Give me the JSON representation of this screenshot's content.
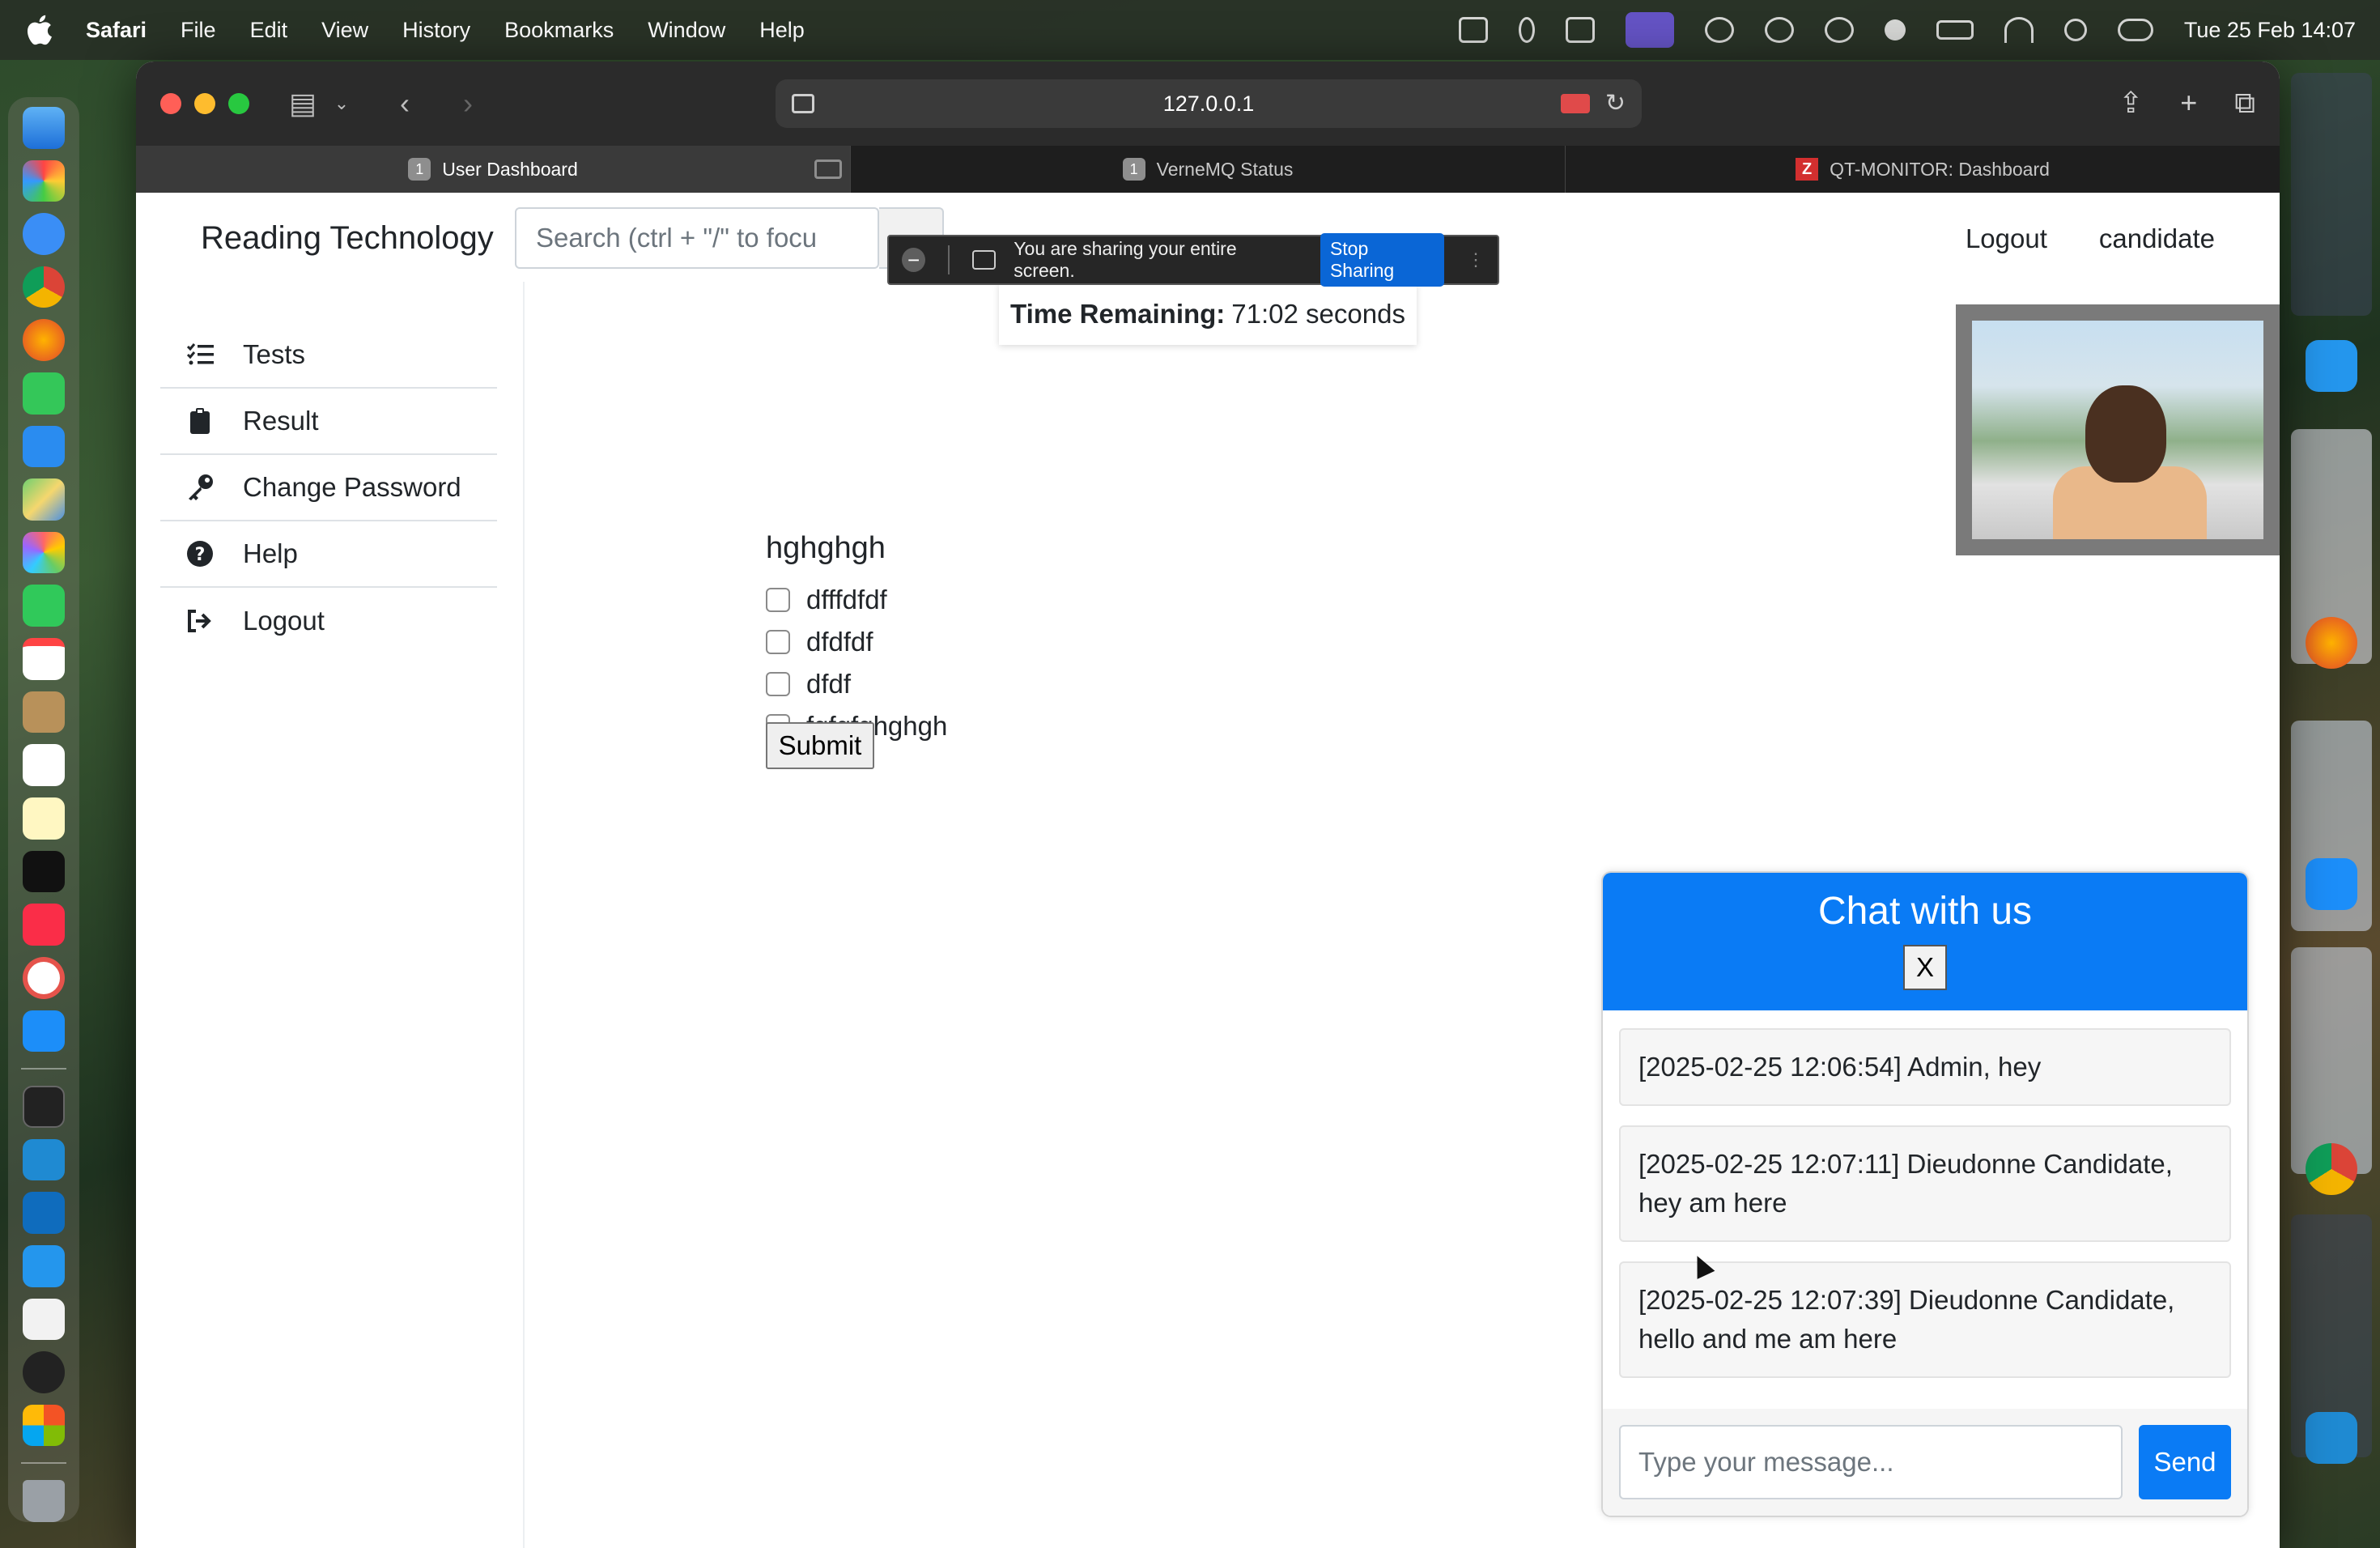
{
  "menubar": {
    "app": "Safari",
    "items": [
      "File",
      "Edit",
      "View",
      "History",
      "Bookmarks",
      "Window",
      "Help"
    ],
    "clock": "Tue 25 Feb  14:07"
  },
  "browser": {
    "address": "127.0.0.1",
    "tabs": [
      {
        "badge": "1",
        "label": "User Dashboard",
        "active": true
      },
      {
        "badge": "1",
        "label": "VerneMQ Status",
        "active": false
      },
      {
        "badge": "Z",
        "label": "QT-MONITOR: Dashboard",
        "active": false
      }
    ]
  },
  "header": {
    "brand": "Reading Technology",
    "search_placeholder": "Search (ctrl + \"/\" to focu",
    "logout": "Logout",
    "user": "candidate"
  },
  "share_banner": {
    "text": "You are sharing your entire screen.",
    "stop_label": "Stop Sharing"
  },
  "timer": {
    "label": "Time Remaining:",
    "value": "71:02 seconds"
  },
  "sidebar": {
    "items": [
      {
        "label": "Tests",
        "icon": "tasks-icon"
      },
      {
        "label": "Result",
        "icon": "clipboard-icon"
      },
      {
        "label": "Change Password",
        "icon": "key-icon"
      },
      {
        "label": "Help",
        "icon": "question-circle-icon"
      },
      {
        "label": "Logout",
        "icon": "sign-out-icon"
      }
    ]
  },
  "question": {
    "title": "hghghgh",
    "options": [
      "dfffdfdf",
      "dfdfdf",
      "dfdf",
      "fgfgfghghgh"
    ],
    "submit_label": "Submit"
  },
  "chat": {
    "title": "Chat with us",
    "close_label": "X",
    "messages": [
      "[2025-02-25 12:06:54] Admin, hey",
      "[2025-02-25 12:07:11] Dieudonne Candidate, hey am here",
      "[2025-02-25 12:07:39] Dieudonne Candidate, hello and me am here"
    ],
    "input_placeholder": "Type your message...",
    "send_label": "Send"
  },
  "colors": {
    "primary": "#0a7bf5",
    "share_stop": "#0a66d6",
    "recording": "#6b57d6"
  }
}
